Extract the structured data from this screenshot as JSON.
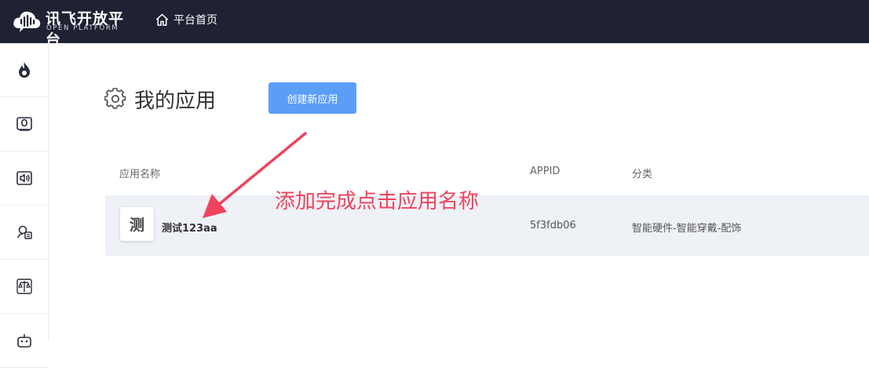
{
  "header": {
    "logo_cn": "讯飞开放平台",
    "logo_en": "OPEN PLATFORM",
    "home_label": "平台首页"
  },
  "sidebar": {
    "items": [
      {
        "icon": "flame-icon"
      },
      {
        "icon": "voice-card-icon"
      },
      {
        "icon": "speaker-icon"
      },
      {
        "icon": "face-doc-icon"
      },
      {
        "icon": "scale-icon"
      },
      {
        "icon": "robot-icon"
      }
    ]
  },
  "page": {
    "title": "我的应用",
    "create_button": "创建新应用"
  },
  "table": {
    "columns": {
      "name": "应用名称",
      "appid": "APPID",
      "category": "分类"
    },
    "rows": [
      {
        "avatar": "测",
        "name": "测试123aa",
        "appid": "5f3fdb06",
        "category": "智能硬件-智能穿戴-配饰"
      }
    ]
  },
  "annotation": {
    "text": "添加完成点击应用名称",
    "color": "#f0435c"
  },
  "colors": {
    "topbar": "#1e2232",
    "accent": "#5b9ef8",
    "row_bg": "#eef1f6"
  }
}
